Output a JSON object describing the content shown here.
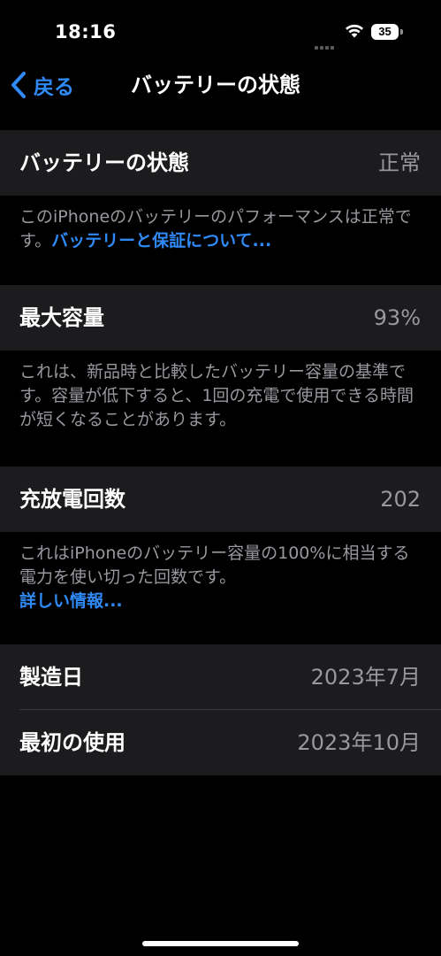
{
  "status_bar": {
    "time": "18:16",
    "battery_level": "35",
    "icons": [
      "signal-icon",
      "wifi-icon",
      "battery-icon"
    ]
  },
  "nav": {
    "back_label": "戻る",
    "title": "バッテリーの状態",
    "back_icon": "chevron-left-icon"
  },
  "battery_health": {
    "label": "バッテリーの状態",
    "value": "正常",
    "footnote_text": "このiPhoneのバッテリーのパフォーマンスは正常です。",
    "footnote_link": "バッテリーと保証について..."
  },
  "maximum_capacity": {
    "label": "最大容量",
    "value": "93%",
    "footnote_text": "これは、新品時と比較したバッテリー容量の基準です。容量が低下すると、1回の充電で使用できる時間が短くなることがあります。"
  },
  "cycle_count": {
    "label": "充放電回数",
    "value": "202",
    "footnote_text": "これはiPhoneのバッテリー容量の100%に相当する電力を使い切った回数です。",
    "footnote_link": "詳しい情報..."
  },
  "dates": {
    "manufacture_label": "製造日",
    "manufacture_value": "2023年7月",
    "first_use_label": "最初の使用",
    "first_use_value": "2023年10月"
  },
  "colors": {
    "background": "#000000",
    "cell_background": "#1c1c1e",
    "accent": "#2f8af7",
    "secondary_text": "#98989f"
  }
}
